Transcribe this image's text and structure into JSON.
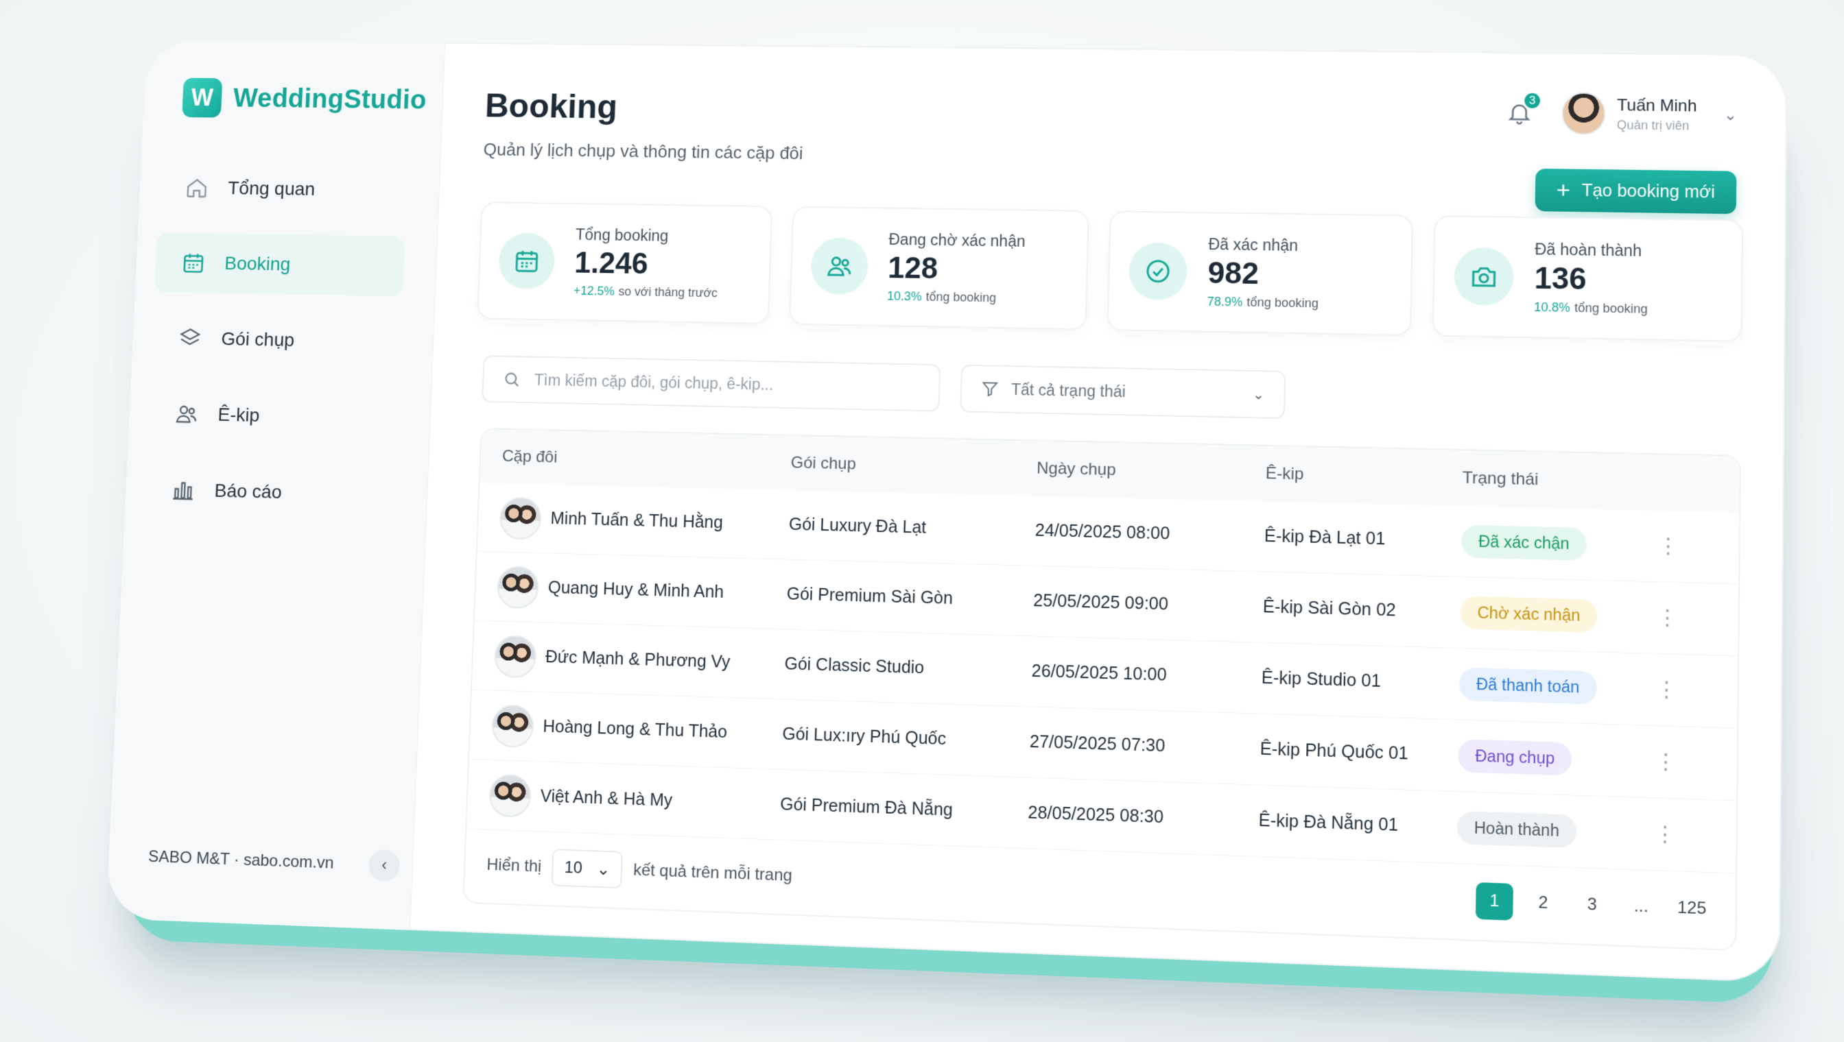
{
  "app": {
    "name": "WeddingStudio",
    "logo_letter": "W"
  },
  "sidebar": {
    "items": [
      {
        "label": "Tổng quan",
        "icon": "home-icon",
        "active": false
      },
      {
        "label": "Booking",
        "icon": "calendar-icon",
        "active": true
      },
      {
        "label": "Gói chụp",
        "icon": "layers-icon",
        "active": false
      },
      {
        "label": "Ê-kip",
        "icon": "users-icon",
        "active": false
      },
      {
        "label": "Báo cáo",
        "icon": "bar-chart-icon",
        "active": false
      }
    ],
    "footer": "SABO M&T · sabo.com.vn"
  },
  "header": {
    "title": "Booking",
    "subtitle": "Quản lý lịch chụp và thông tin các cặp đôi",
    "notification_count": "3",
    "user_name": "Tuấn Minh",
    "user_role": "Quản trị viên",
    "new_button": "Tạo booking mới"
  },
  "stats": [
    {
      "label": "Tổng booking",
      "value": "1.246",
      "pct": "+12.5%",
      "note": "so với tháng trước",
      "icon": "calendar-icon"
    },
    {
      "label": "Đang chờ xác nhận",
      "value": "128",
      "pct": "10.3%",
      "note": "tổng booking",
      "icon": "users-icon"
    },
    {
      "label": "Đã xác nhận",
      "value": "982",
      "pct": "78.9%",
      "note": "tổng booking",
      "icon": "check-circle-icon"
    },
    {
      "label": "Đã hoàn thành",
      "value": "136",
      "pct": "10.8%",
      "note": "tổng booking",
      "icon": "camera-icon"
    }
  ],
  "filters": {
    "search_placeholder": "Tìm kiếm cặp đôi, gói chụp, ê-kip...",
    "status_value": "Tất cả trạng thái"
  },
  "table": {
    "columns": [
      "Cặp đôi",
      "Gói chụp",
      "Ngày chụp",
      "Ê-kip",
      "Trạng thái"
    ],
    "rows": [
      {
        "couple": "Minh Tuấn & Thu Hằng",
        "package": "Gói Luxury Đà Lạt",
        "date": "24/05/2025 08:00",
        "team": "Ê-kip Đà Lạt 01",
        "status": "Đã xác chận"
      },
      {
        "couple": "Quang Huy & Minh Anh",
        "package": "Gói Premium Sài Gòn",
        "date": "25/05/2025 09:00",
        "team": "Ê-kip Sài Gòn 02",
        "status": "Chờ xác nhận"
      },
      {
        "couple": "Đức Mạnh & Phương Vy",
        "package": "Gói Classic Studio",
        "date": "26/05/2025 10:00",
        "team": "Ê-kip Studio 01",
        "status": "Đã thanh toán"
      },
      {
        "couple": "Hoàng Long & Thu Thảo",
        "package": "Gói Lux:ıry Phú Quốc",
        "date": "27/05/2025 07:30",
        "team": "Ê-kip Phú Quốc 01",
        "status": "Đang chụp"
      },
      {
        "couple": "Việt Anh & Hà My",
        "package": "Gói Premium Đà Nẵng",
        "date": "28/05/2025 08:30",
        "team": "Ê-kip Đà Nẵng 01",
        "status": "Hoàn thành"
      }
    ],
    "status_colors": {
      "confirmed": "#1a9a68",
      "pending": "#c79412",
      "paid": "#2d7ad4",
      "shooting": "#6c4fc9",
      "done": "#4f5a64"
    }
  },
  "footer": {
    "show_label": "Hiển thị",
    "per_page": "10",
    "per_page_suffix": "kết quả trên mỗi trang",
    "pages": [
      "1",
      "2",
      "3",
      "...",
      "125"
    ],
    "current_page": "1"
  },
  "colors": {
    "accent": "#16a696"
  }
}
